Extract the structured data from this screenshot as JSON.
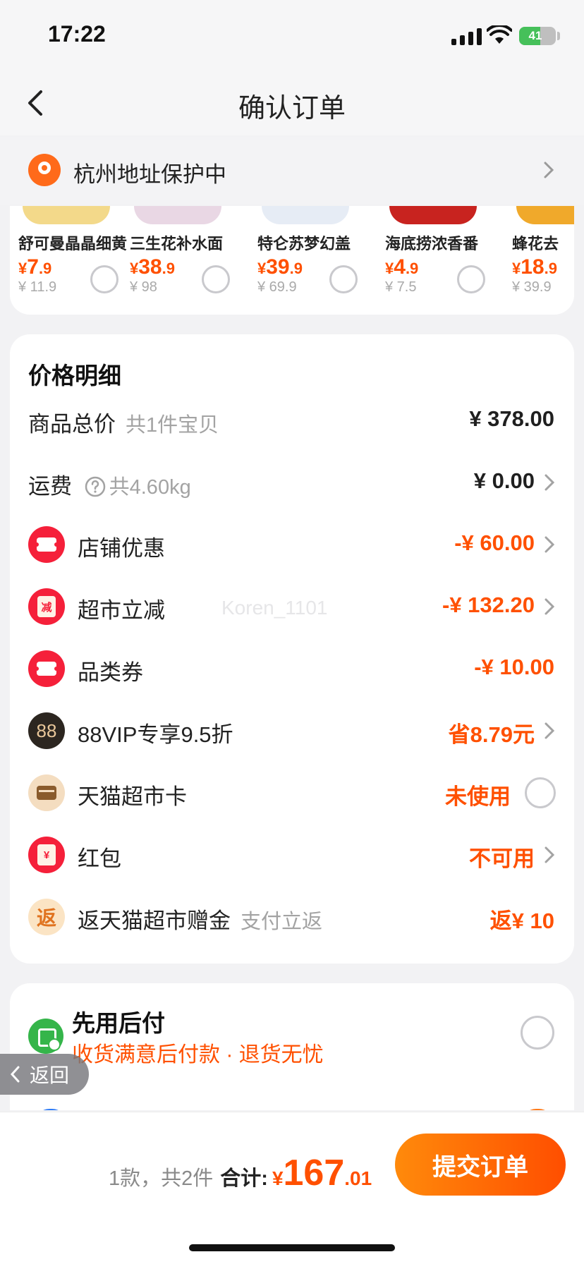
{
  "status_bar": {
    "time": "17:22",
    "battery": "41"
  },
  "nav": {
    "title": "确认订单"
  },
  "address": {
    "text": "杭州地址保护中"
  },
  "products": [
    {
      "name": "舒可曼晶晶细黄",
      "cur": "¥",
      "int": "7",
      "dec": ".9",
      "orig": "¥ 11.9",
      "img_color": "#f3d98a"
    },
    {
      "name": "三生花补水面",
      "cur": "¥",
      "int": "38",
      "dec": ".9",
      "orig": "¥ 98",
      "img_color": "#e9d7e4"
    },
    {
      "name": "特仑苏梦幻盖",
      "cur": "¥",
      "int": "39",
      "dec": ".9",
      "orig": "¥ 69.9",
      "img_color": "#e6ecf5"
    },
    {
      "name": "海底捞浓香番",
      "cur": "¥",
      "int": "4",
      "dec": ".9",
      "orig": "¥ 7.5",
      "img_color": "#c8231f"
    },
    {
      "name": "蜂花去",
      "cur": "¥",
      "int": "18",
      "dec": ".9",
      "orig": "¥ 39.9",
      "img_color": "#f0a92b"
    }
  ],
  "price_detail": {
    "title": "价格明细",
    "rows": [
      {
        "label": "商品总价",
        "sub": "共1件宝贝",
        "value": "¥ 378.00"
      },
      {
        "label": "运费",
        "sub": "共4.60kg",
        "value": "¥ 0.00"
      },
      {
        "label": "店铺优惠",
        "value": "-¥ 60.00"
      },
      {
        "label": "超市立减",
        "value": "-¥ 132.20",
        "icon_text": "减"
      },
      {
        "label": "品类券",
        "value": "-¥ 10.00"
      },
      {
        "label": "88VIP专享9.5折",
        "value": "省8.79元",
        "icon_text": "88"
      },
      {
        "label": "天猫超市卡",
        "value": "未使用"
      },
      {
        "label": "红包",
        "value": "不可用",
        "icon_text": "¥"
      },
      {
        "label": "返天猫超市赠金",
        "sub": "支付立返",
        "value": "返¥ 10",
        "icon_text": "返"
      }
    ]
  },
  "pay_later": {
    "title": "先用后付",
    "subtitle": "收货满意后付款 · 退货无忧"
  },
  "return_button": {
    "label": "返回"
  },
  "footer": {
    "count": "1款，共2件",
    "total_label": "合计:",
    "total_cur": "¥",
    "total_int": "167",
    "total_dec": ".01",
    "submit_label": "提交订单"
  },
  "watermark": "Koren_1101",
  "colors": {
    "accent": "#ff5000",
    "coupon_red": "#f5203a",
    "paylater_green": "#35b54a"
  }
}
